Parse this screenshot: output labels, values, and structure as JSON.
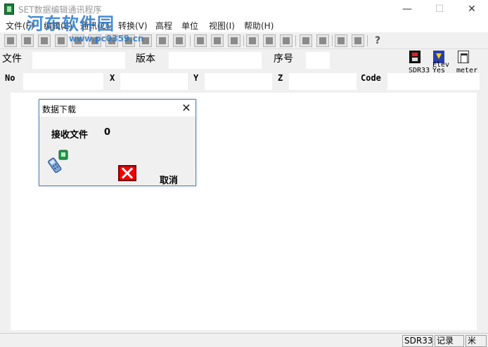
{
  "window": {
    "title": "SET数据编辑通讯程序",
    "controls": {
      "minimize": "—",
      "maximize": "☐",
      "close": "✕"
    }
  },
  "watermark": {
    "text": "河东软件园",
    "url": "www.pc0359.cn"
  },
  "menu": [
    "文件(F)",
    "编辑(E)",
    "通讯(C)",
    "转换(V)",
    "高程",
    "单位",
    "视图(I)",
    "帮助(H)"
  ],
  "toolbar": {
    "help": "?"
  },
  "header": {
    "file_label": "文件",
    "version_label": "版本",
    "serial_label": "序号",
    "sdr_label": "SDR33",
    "elev_label": "Elev",
    "elev_sub": "Yes",
    "meter_label": "meter"
  },
  "columns": {
    "no": "No",
    "x": "X",
    "y": "Y",
    "z": "Z",
    "code": "Code"
  },
  "dialog": {
    "title": "数据下载",
    "close": "✕",
    "recv_label": "接收文件",
    "recv_count": "0",
    "cancel_label": "取消"
  },
  "statusbar": {
    "format": "SDR33",
    "record": "记录",
    "unit": "米"
  }
}
